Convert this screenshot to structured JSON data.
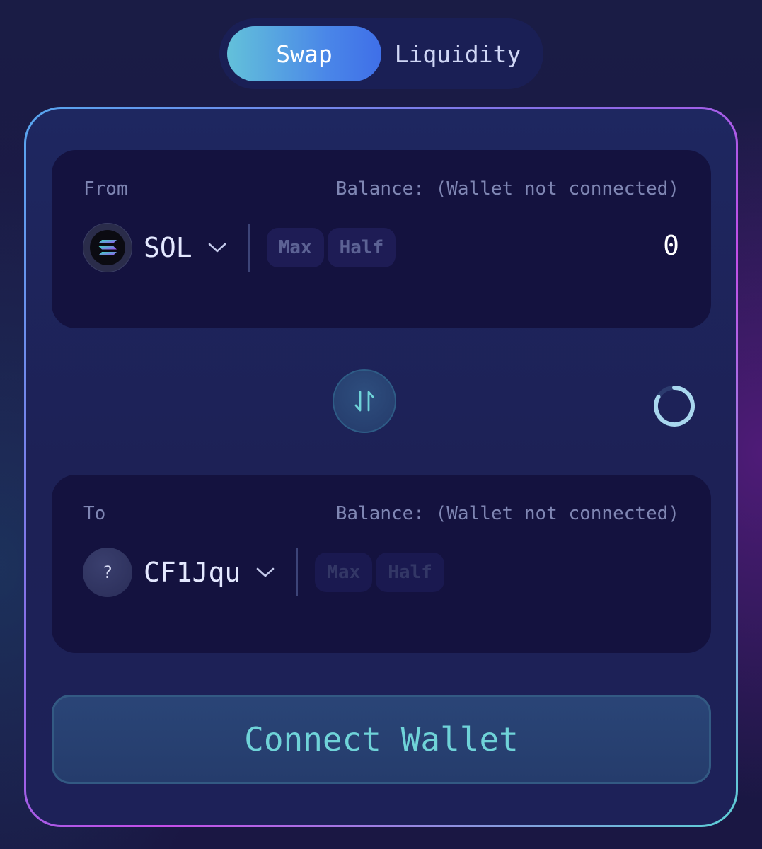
{
  "tabs": {
    "swap_label": "Swap",
    "liquidity_label": "Liquidity",
    "active": "Swap"
  },
  "from": {
    "label": "From",
    "balance": "Balance: (Wallet not connected)",
    "token": {
      "symbol": "SOL",
      "icon": "solana-logo-icon"
    },
    "max_label": "Max",
    "half_label": "Half",
    "amount": "0"
  },
  "to": {
    "label": "To",
    "balance": "Balance: (Wallet not connected)",
    "token": {
      "symbol": "CF1Jqu",
      "icon": "unknown-token-icon",
      "icon_text": "?"
    },
    "max_label": "Max",
    "half_label": "Half"
  },
  "swap_direction": {
    "icon": "swap-direction-icon"
  },
  "loading": {
    "icon": "loading-spinner-icon"
  },
  "connect_button": {
    "label": "Connect Wallet"
  },
  "colors": {
    "accent_gradient_start": "#63c1da",
    "accent_gradient_end": "#3f6fe8",
    "connect_text": "#6fd3d8",
    "panel_bg": "#14123f",
    "card_bg": "#1e2760"
  }
}
